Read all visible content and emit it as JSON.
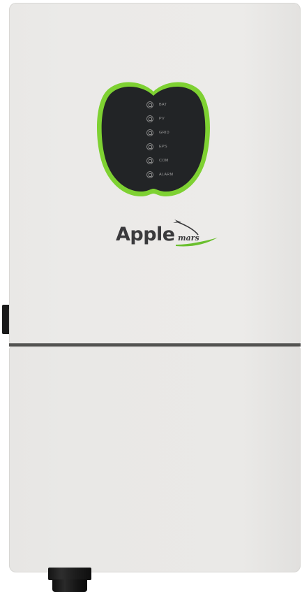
{
  "product": {
    "brand_primary": "Apple",
    "brand_secondary": "mars",
    "colors": {
      "housing": "#ebeae8",
      "panel": "#222426",
      "panel_ring": "#7ed132",
      "logo_text": "#3a3a3c",
      "logo_accent": "#6abf2e"
    }
  },
  "indicators": [
    {
      "label": "BAT",
      "icon": "battery-icon"
    },
    {
      "label": "PV",
      "icon": "solar-panel-icon"
    },
    {
      "label": "GRID",
      "icon": "grid-tower-icon"
    },
    {
      "label": "EPS",
      "icon": "eps-outlet-icon"
    },
    {
      "label": "COM",
      "icon": "communication-icon"
    },
    {
      "label": "ALARM",
      "icon": "alarm-warning-icon"
    }
  ]
}
